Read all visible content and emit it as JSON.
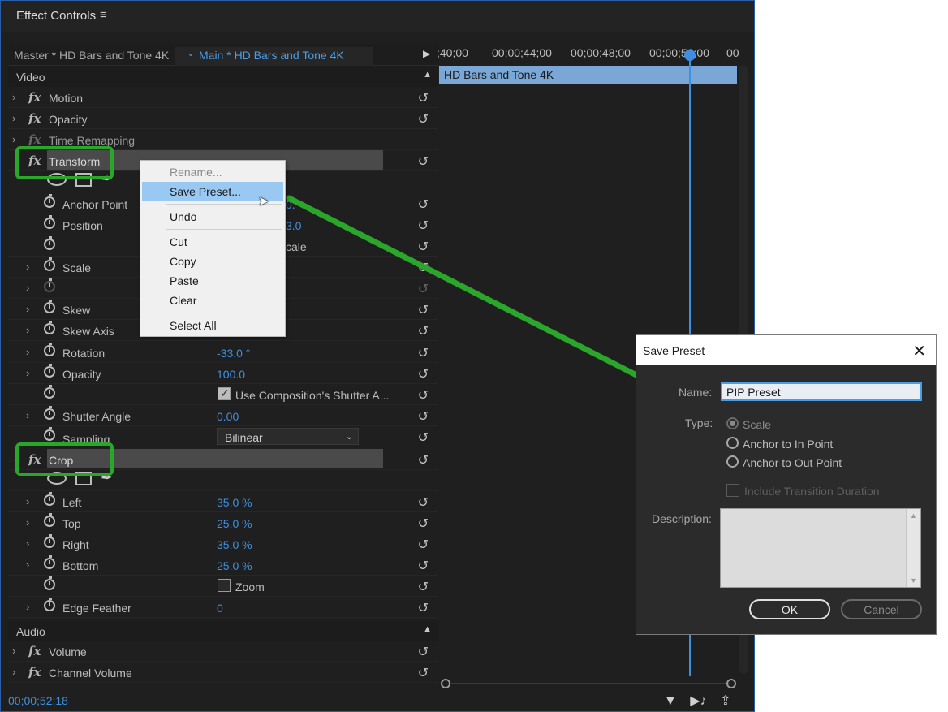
{
  "panel": {
    "title": "Effect Controls",
    "menu_icon": "≡",
    "source_master": "Master * HD Bars and Tone 4K",
    "source_main": "Main * HD Bars and Tone 4K"
  },
  "sections": {
    "video": "Video",
    "audio": "Audio"
  },
  "effects": {
    "motion": "Motion",
    "opacity": "Opacity",
    "time_remapping": "Time Remapping",
    "transform": "Transform",
    "crop": "Crop",
    "volume": "Volume",
    "channel_volume": "Channel Volume"
  },
  "transform_props": {
    "anchor_point": "Anchor Point",
    "anchor_point_value_partial": "0.",
    "position": "Position",
    "position_value_partial": "3.0",
    "uniform_scale_partial": "cale",
    "scale": "Scale",
    "skew": "Skew",
    "skew_axis": "Skew Axis",
    "rotation": "Rotation",
    "rotation_value": "-33.0 °",
    "opacity": "Opacity",
    "opacity_value": "100.0",
    "use_comp_shutter": "Use Composition's Shutter A...",
    "use_comp_shutter_checked": true,
    "shutter_angle": "Shutter Angle",
    "shutter_angle_value": "0.00",
    "sampling": "Sampling",
    "sampling_value": "Bilinear"
  },
  "crop_props": {
    "left": "Left",
    "left_value": "35.0 %",
    "top": "Top",
    "top_value": "25.0 %",
    "right": "Right",
    "right_value": "35.0 %",
    "bottom": "Bottom",
    "bottom_value": "25.0 %",
    "zoom": "Zoom",
    "zoom_checked": false,
    "edge_feather": "Edge Feather",
    "edge_feather_value": "0"
  },
  "timeline": {
    "ticks": [
      ";40;00",
      "00;00;44;00",
      "00;00;48;00",
      "00;00;52;00",
      "00"
    ],
    "clip_label": "HD Bars and Tone 4K"
  },
  "status": {
    "timecode": "00;00;52;18"
  },
  "context_menu": {
    "items": [
      "Rename...",
      "Save Preset...",
      "Undo",
      "Cut",
      "Copy",
      "Paste",
      "Clear",
      "Select All"
    ],
    "disabled": [
      "Rename..."
    ],
    "highlighted": "Save Preset..."
  },
  "dialog": {
    "title": "Save Preset",
    "name_label": "Name:",
    "name_value": "PIP Preset",
    "type_label": "Type:",
    "type_options": [
      "Scale",
      "Anchor to In Point",
      "Anchor to Out Point"
    ],
    "type_selected": "Scale",
    "include_transition": "Include Transition Duration",
    "description_label": "Description:",
    "description_value": "",
    "ok_label": "OK",
    "cancel_label": "Cancel"
  },
  "colors": {
    "accent_blue": "#3f8fe0",
    "highlight_green": "#2aa62a",
    "clip_blue": "#7aa7d6",
    "menu_hover": "#99c9f3"
  }
}
